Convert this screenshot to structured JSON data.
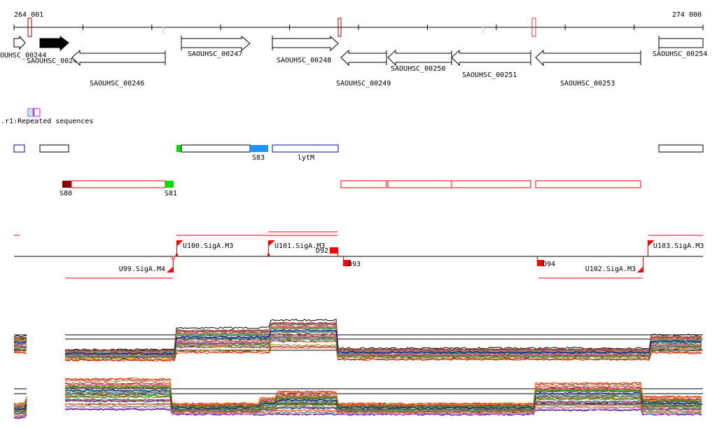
{
  "ruler": {
    "start_label": "264 001",
    "end_label": "274 000"
  },
  "genes": [
    {
      "id": "OUHSC_00244",
      "strand": "+"
    },
    {
      "id": "SAOUHSC_00245",
      "strand": "+",
      "selected": true
    },
    {
      "id": "SAOUHSC_00246",
      "strand": "-"
    },
    {
      "id": "SAOUHSC_00247",
      "strand": "+"
    },
    {
      "id": "SAOUHSC_00248",
      "strand": "+"
    },
    {
      "id": "SAOUHSC_00249",
      "strand": "-"
    },
    {
      "id": "SAOUHSC_00250",
      "strand": "-"
    },
    {
      "id": "SAOUHSC_00251",
      "strand": "-"
    },
    {
      "id": "SAOUHSC_00253",
      "strand": "-"
    },
    {
      "id": "SAOUHSC_00254",
      "strand": "+"
    }
  ],
  "repeats": {
    "label": ".r1:Repeated sequences"
  },
  "segments_top": {
    "s83": "S83",
    "lytm": "lytM"
  },
  "segments_red": {
    "s80": "S80",
    "s81": "S81"
  },
  "promoters": {
    "u99": "U99.SigA.M4",
    "u100": "U100.SigA.M3",
    "u101": "U101.SigA.M3",
    "u102": "U102.SigA.M3",
    "u103": "U103.SigA.M3",
    "d92": "D92",
    "d93": "D93",
    "d94": "D94"
  },
  "colors": {
    "promoter": "#ff0000",
    "segment_blue": "#1e90ff",
    "segment_green": "#00e000",
    "segment_darkred": "#8b0000"
  }
}
